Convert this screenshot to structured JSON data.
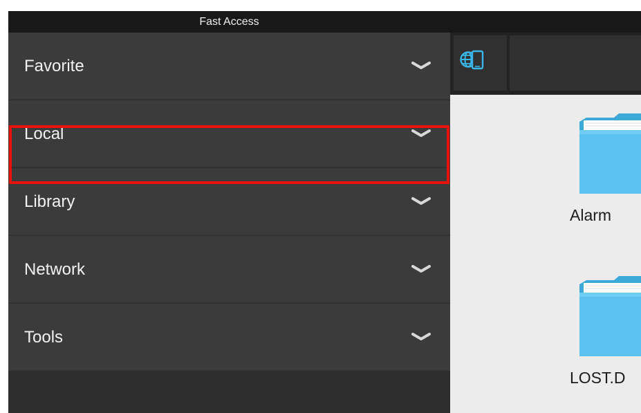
{
  "title_bar": {
    "title": "Fast Access"
  },
  "sidebar": {
    "items": [
      {
        "label": "Favorite",
        "icon": "chevron-down-icon"
      },
      {
        "label": "Local",
        "icon": "chevron-down-icon",
        "selected": true
      },
      {
        "label": "Library",
        "icon": "chevron-down-icon"
      },
      {
        "label": "Network",
        "icon": "chevron-down-icon"
      },
      {
        "label": "Tools",
        "icon": "chevron-down-icon"
      }
    ]
  },
  "toolbar": {
    "view_button_icon": "globe-device-icon"
  },
  "content": {
    "folders": [
      {
        "name": "Alarm",
        "icon": "folder-icon"
      },
      {
        "name": "LOST.D",
        "icon": "folder-icon"
      }
    ]
  },
  "colors": {
    "highlight": "#e8120c",
    "folder": "#5bc2ef",
    "accent": "#39b7ea"
  }
}
